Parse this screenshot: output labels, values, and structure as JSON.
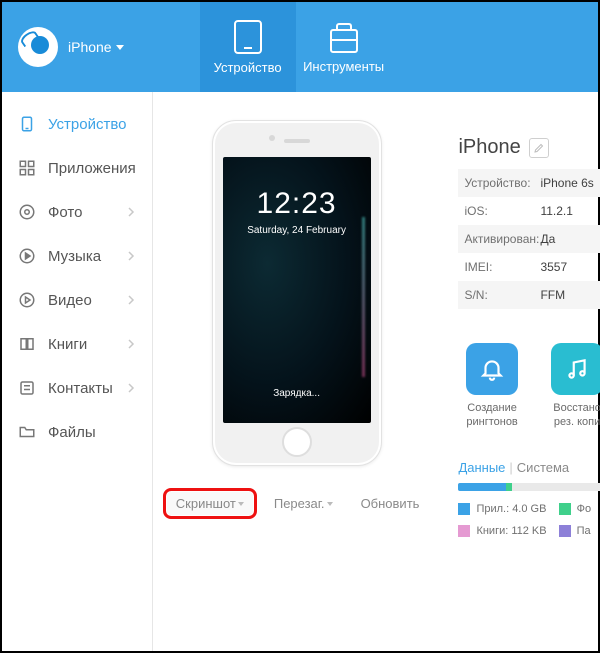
{
  "header": {
    "brand_label": "iPhone",
    "tabs": {
      "device": "Устройство",
      "tools": "Инструменты"
    }
  },
  "sidebar": {
    "items": [
      {
        "id": "device",
        "label": "Устройство",
        "active": true,
        "expandable": false
      },
      {
        "id": "apps",
        "label": "Приложения",
        "active": false,
        "expandable": false
      },
      {
        "id": "photos",
        "label": "Фото",
        "active": false,
        "expandable": true
      },
      {
        "id": "music",
        "label": "Музыка",
        "active": false,
        "expandable": true
      },
      {
        "id": "video",
        "label": "Видео",
        "active": false,
        "expandable": true
      },
      {
        "id": "books",
        "label": "Книги",
        "active": false,
        "expandable": true
      },
      {
        "id": "contacts",
        "label": "Контакты",
        "active": false,
        "expandable": true
      },
      {
        "id": "files",
        "label": "Файлы",
        "active": false,
        "expandable": false
      }
    ]
  },
  "phone_preview": {
    "time": "12:23",
    "date": "Saturday, 24 February",
    "status": "Зарядка..."
  },
  "phone_actions": {
    "screenshot": "Скриншот",
    "reboot": "Перезаг.",
    "refresh": "Обновить"
  },
  "device_info": {
    "title": "iPhone",
    "rows": [
      {
        "key": "Устройство:",
        "value": "iPhone 6s"
      },
      {
        "key": "iOS:",
        "value": "11.2.1"
      },
      {
        "key": "Активирован:",
        "value": "Да"
      },
      {
        "key": "IMEI:",
        "value": "3557"
      },
      {
        "key": "S/N:",
        "value": "FFM"
      }
    ]
  },
  "shortcuts": {
    "ringtone": "Создание рингтонов",
    "backup": "Восстано рез. копи"
  },
  "storage": {
    "tabs": {
      "data": "Данные",
      "system": "Система"
    },
    "legend": {
      "apps": "Прил.: 4.0 GB",
      "photos": "Фо",
      "books": "Книги: 112 KB",
      "other": "Па"
    }
  }
}
